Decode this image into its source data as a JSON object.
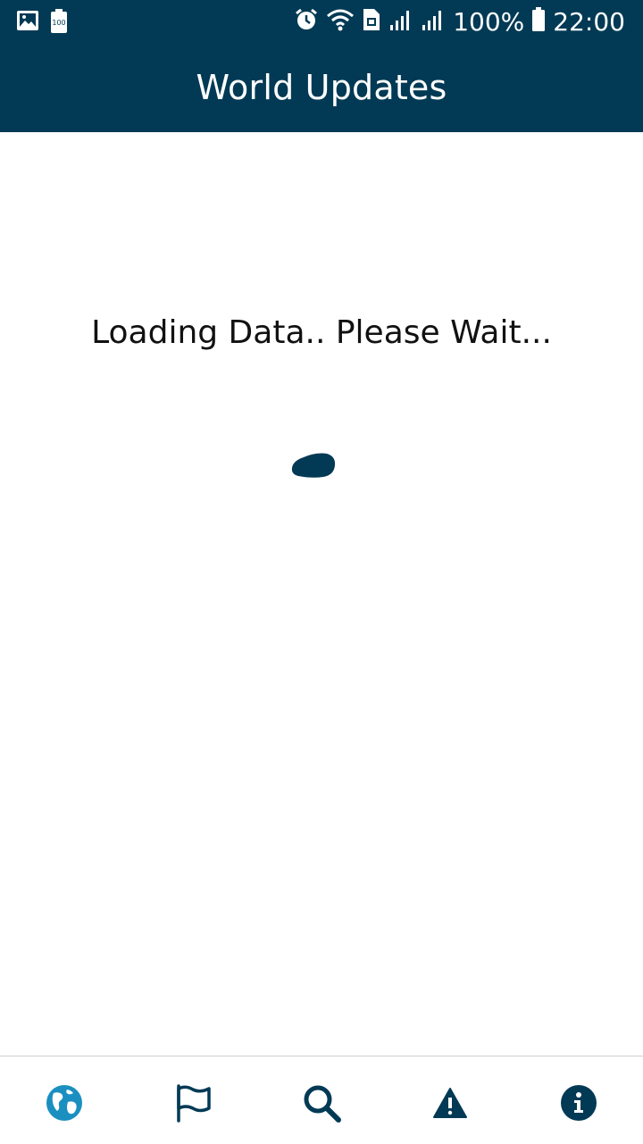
{
  "status_bar": {
    "battery_percent": "100%",
    "time": "22:00",
    "left_icons": [
      "image-icon",
      "battery-saver-icon"
    ],
    "right_icons": [
      "alarm-icon",
      "wifi-icon",
      "sim-icon",
      "signal-icon",
      "signal-icon",
      "battery-icon"
    ],
    "notification_battery_label": "100"
  },
  "header": {
    "title": "World Updates"
  },
  "main": {
    "loading_text": "Loading Data.. Please Wait..."
  },
  "bottom_nav": {
    "items": [
      {
        "icon": "globe-icon",
        "active": true
      },
      {
        "icon": "flag-icon",
        "active": false
      },
      {
        "icon": "search-icon",
        "active": false
      },
      {
        "icon": "warning-icon",
        "active": false
      },
      {
        "icon": "info-icon",
        "active": false
      }
    ]
  },
  "colors": {
    "primary": "#023A55",
    "accent": "#1A8FC0",
    "background": "#FFFFFF"
  }
}
